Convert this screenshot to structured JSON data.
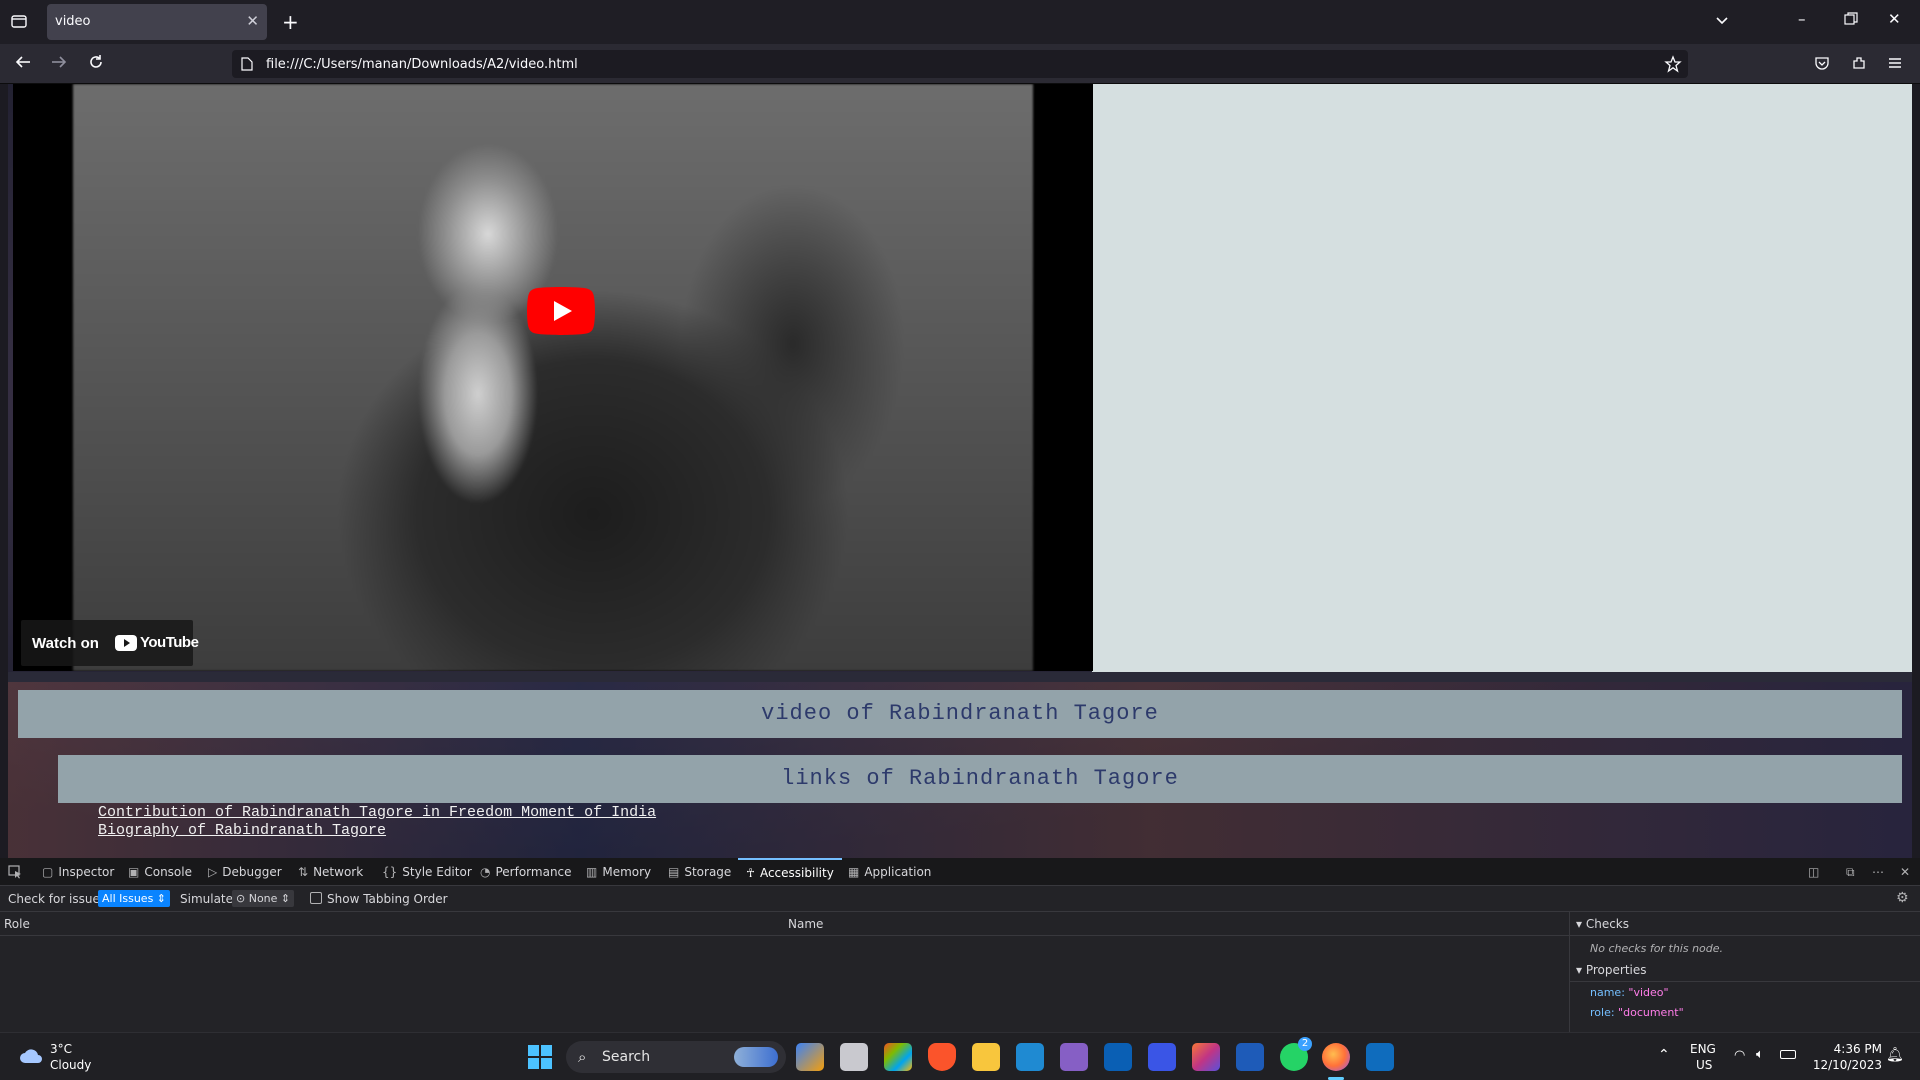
{
  "browser": {
    "tab_title": "video",
    "url": "file:///C:/Users/manan/Downloads/A2/video.html"
  },
  "page": {
    "video": {
      "watch_on_label": "Watch on",
      "youtube_label": "YouTube"
    },
    "heading_video": "video of Rabindranath Tagore",
    "heading_links": "links of Rabindranath Tagore",
    "links": [
      "Contribution of Rabindranath Tagore in Freedom Moment of India",
      "Biography of Rabindranath Tagore"
    ]
  },
  "devtools": {
    "tabs": [
      {
        "label": "Inspector",
        "icon": "inspector-icon"
      },
      {
        "label": "Console",
        "icon": "console-icon"
      },
      {
        "label": "Debugger",
        "icon": "debugger-icon"
      },
      {
        "label": "Network",
        "icon": "network-icon"
      },
      {
        "label": "Style Editor",
        "icon": "style-editor-icon"
      },
      {
        "label": "Performance",
        "icon": "performance-icon"
      },
      {
        "label": "Memory",
        "icon": "memory-icon"
      },
      {
        "label": "Storage",
        "icon": "storage-icon"
      },
      {
        "label": "Accessibility",
        "icon": "accessibility-icon",
        "active": true
      },
      {
        "label": "Application",
        "icon": "application-icon"
      }
    ],
    "toolbar": {
      "check_label": "Check for issues:",
      "check_value": "All Issues",
      "simulate_label": "Simulate:",
      "simulate_value": "None",
      "tabbing_label": "Show Tabbing Order"
    },
    "tree": {
      "col_role": "Role",
      "col_name": "Name"
    },
    "sidebar": {
      "checks_header": "Checks",
      "checks_note": "No checks for this node.",
      "properties_header": "Properties",
      "prop_name_key": "name:",
      "prop_name_val": "\"video\"",
      "prop_role_key": "role:",
      "prop_role_val": "\"document\""
    }
  },
  "taskbar": {
    "weather_temp": "3°C",
    "weather_desc": "Cloudy",
    "search_label": "Search",
    "lang_top": "ENG",
    "lang_bottom": "US",
    "time": "4:36 PM",
    "date": "12/10/2023",
    "whatsapp_badge": "2"
  },
  "colors": {
    "heading_bg": "#93a3aa",
    "heading_text": "#2d3a6b",
    "youtube_red": "#ff0000",
    "devtools_accent": "#75bfff"
  }
}
